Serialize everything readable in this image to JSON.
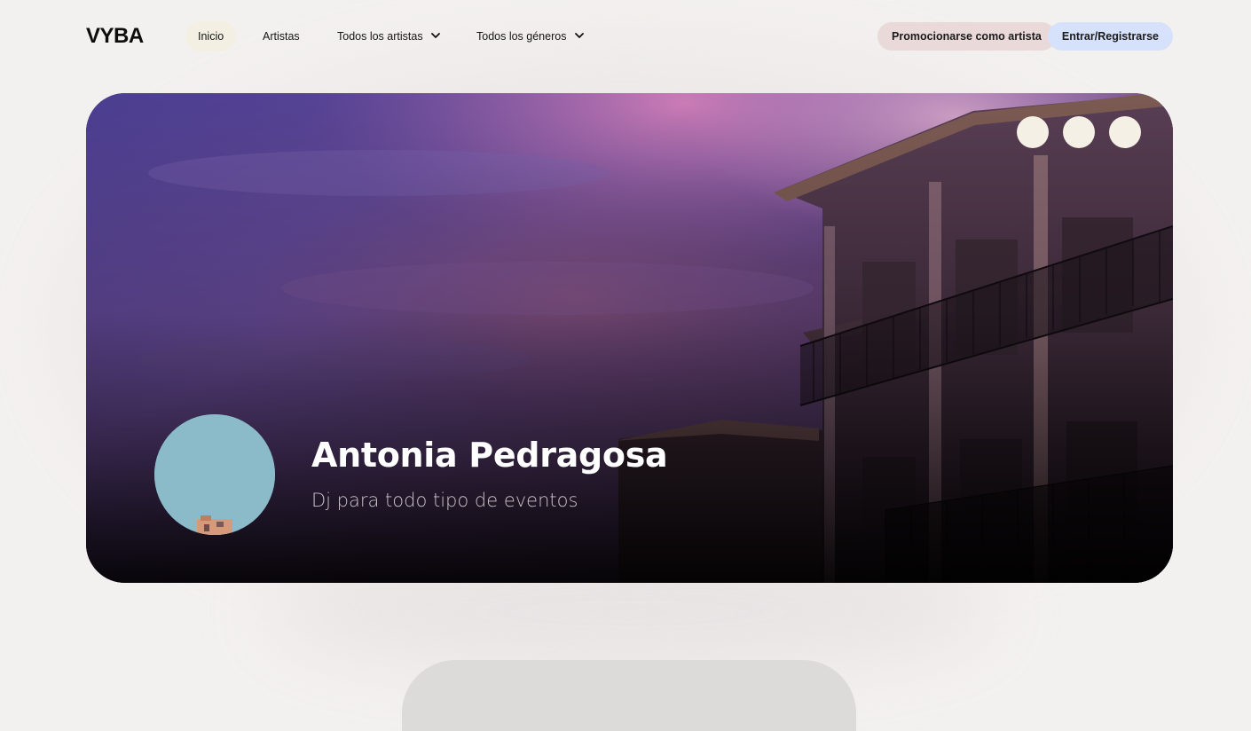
{
  "nav": {
    "logo": "VYBA",
    "links": [
      {
        "label": "Inicio",
        "active": true
      },
      {
        "label": "Artistas"
      },
      {
        "label": "Todos los artistas",
        "dropdown": true,
        "icon": "chevron-down-icon"
      },
      {
        "label": "Todos los géneros",
        "dropdown": true,
        "icon": "chevron-down-icon"
      }
    ],
    "promo_button": "Promocionarse como artista",
    "login_button": "Entrar/Registrarse"
  },
  "hero": {
    "artist_name": "Antonia Pedragosa",
    "artist_subtitle": "Dj para todo tipo de eventos",
    "carousel_dots": 3
  },
  "colors": {
    "page_bg": "#f3f1ef",
    "promo_bg": "#e9d9d9",
    "login_bg": "#d6e1fb",
    "active_nav_bg": "#f3efe2",
    "dot": "#f4f0e6"
  }
}
